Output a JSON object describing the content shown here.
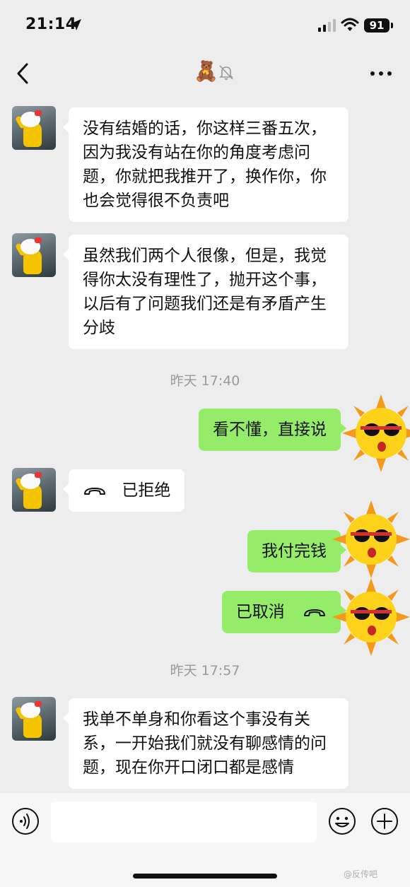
{
  "status_bar": {
    "time": "21:14",
    "battery": "91"
  },
  "header": {
    "title_emoji": "🧸"
  },
  "messages": [
    {
      "text": "没有结婚的话，你这样三番五次，因为我没有站在你的角度考虑问题，你就把我推开了，换作你，你也会觉得很不负责吧"
    },
    {
      "text": "虽然我们两个人很像，但是，我觉得你太没有理性了，抛开这个事，以后有了问题我们还是有矛盾产生分歧"
    },
    {
      "time": "昨天 17:40"
    },
    {
      "text": "看不懂，直接说"
    },
    {
      "text": "已拒绝"
    },
    {
      "text": "我付完钱"
    },
    {
      "text": "已取消"
    },
    {
      "time": "昨天 17:57"
    },
    {
      "text": "我单不单身和你看这个事没有关系，一开始我们就没有聊感情的问题，现在你开口闭口都是感情"
    }
  ],
  "input": {
    "placeholder": ""
  },
  "watermark": "@反传吧",
  "colors": {
    "outgoing_bubble": "#95ec69",
    "incoming_bubble": "#ffffff",
    "background": "#ededed"
  }
}
